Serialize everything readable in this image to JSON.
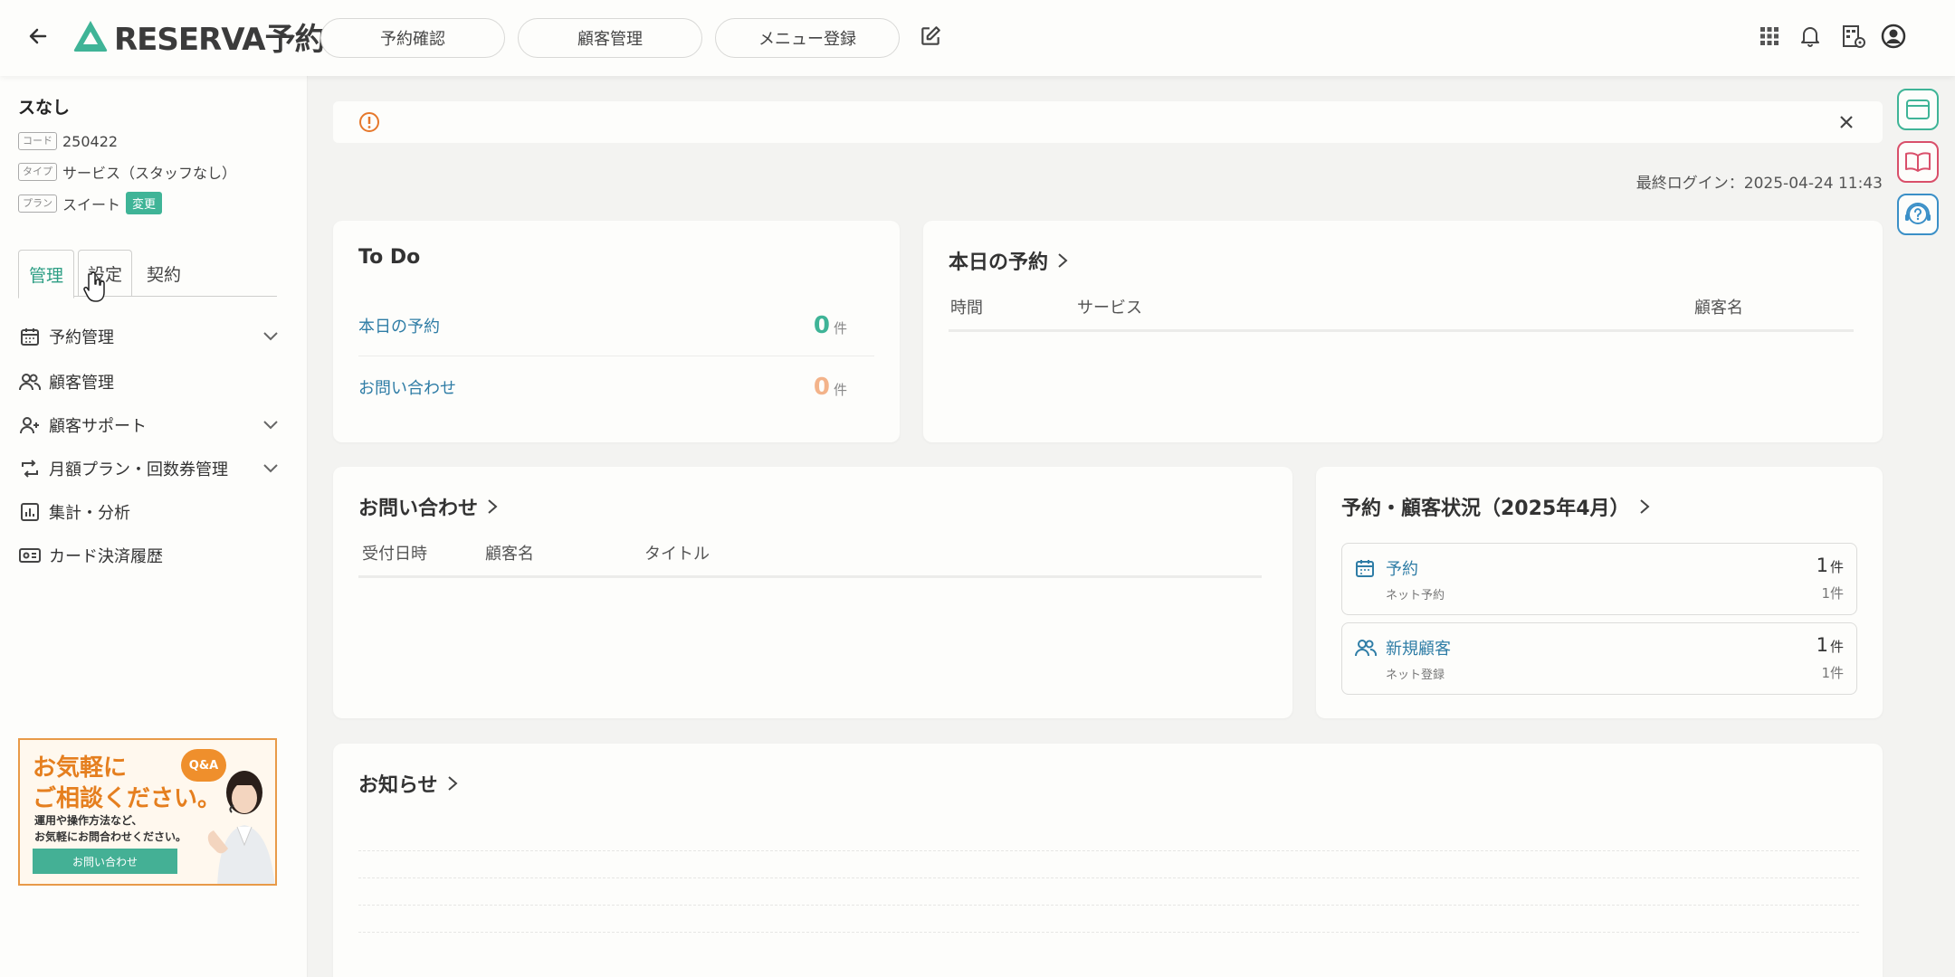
{
  "header": {
    "logo_text": "RESERVA予約",
    "nav": [
      "予約確認",
      "顧客管理",
      "メニュー登録"
    ]
  },
  "sidebar": {
    "shop_name": "スなし",
    "code_tag": "コード",
    "code_value": "250422",
    "type_tag": "タイプ",
    "type_value": "サービス（スタッフなし）",
    "plan_tag": "プラン",
    "plan_value": "スイート",
    "change_label": "変更",
    "tabs": [
      "管理",
      "設定",
      "契約"
    ],
    "menu": [
      {
        "label": "予約管理",
        "icon": "calendar-icon",
        "expandable": true
      },
      {
        "label": "顧客管理",
        "icon": "users-icon",
        "expandable": false
      },
      {
        "label": "顧客サポート",
        "icon": "user-plus-icon",
        "expandable": true
      },
      {
        "label": "月額プラン・回数券管理",
        "icon": "repeat-icon",
        "expandable": true
      },
      {
        "label": "集計・分析",
        "icon": "chart-icon",
        "expandable": false
      },
      {
        "label": "カード決済履歴",
        "icon": "card-icon",
        "expandable": false
      }
    ],
    "banner": {
      "title1": "お気軽に",
      "title2": "ご相談ください。",
      "sub1": "運用や操作方法など、",
      "sub2": "お気軽にお問合わせください。",
      "button": "お問い合わせ",
      "badge": "Q&A"
    }
  },
  "main": {
    "last_login": "最終ログイン：2025-04-24 11:43",
    "todo": {
      "title": "To Do",
      "rows": [
        {
          "label": "本日の予約",
          "count": "0",
          "unit": "件",
          "color": "#3fb497"
        },
        {
          "label": "お問い合わせ",
          "count": "0",
          "unit": "件",
          "color": "#f3b38a"
        }
      ]
    },
    "today": {
      "title": "本日の予約",
      "headers": [
        "時間",
        "サービス",
        "顧客名"
      ]
    },
    "inquiry": {
      "title": "お問い合わせ",
      "headers": [
        "受付日時",
        "顧客名",
        "タイトル"
      ]
    },
    "status": {
      "title": "予約・顧客状況（2025年4月）",
      "items": [
        {
          "label": "予約",
          "sub": "ネット予約",
          "count": "1",
          "unit": "件",
          "sub_count": "1",
          "sub_unit": "件",
          "icon": "calendar-icon"
        },
        {
          "label": "新規顧客",
          "sub": "ネット登録",
          "count": "1",
          "unit": "件",
          "sub_count": "1",
          "sub_unit": "件",
          "icon": "users-icon"
        }
      ]
    },
    "notice": {
      "title": "お知らせ"
    }
  },
  "colors": {
    "accent": "#3fb497",
    "link": "#2f7da6",
    "orange": "#e57f1f"
  }
}
